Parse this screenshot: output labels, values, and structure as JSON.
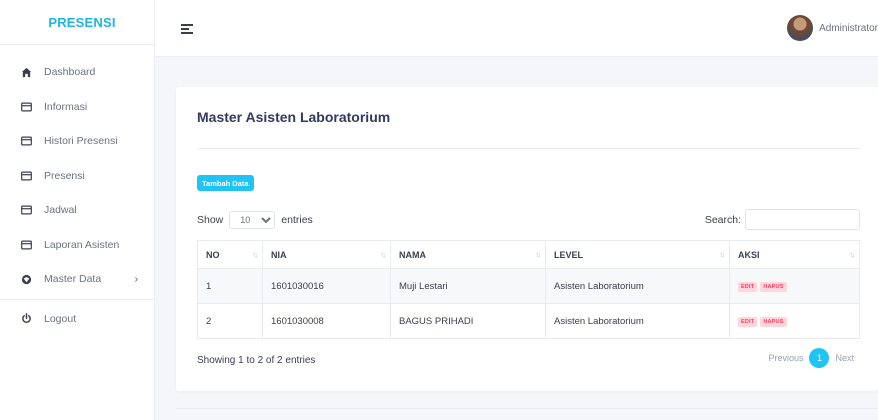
{
  "sidebar": {
    "brand": "PRESENSI",
    "items": [
      {
        "label": "Dashboard",
        "icon": "home-icon"
      },
      {
        "label": "Informasi",
        "icon": "card-icon"
      },
      {
        "label": "Histori Presensi",
        "icon": "card-icon"
      },
      {
        "label": "Presensi",
        "icon": "card-icon"
      },
      {
        "label": "Jadwal",
        "icon": "card-icon"
      },
      {
        "label": "Laporan Asisten",
        "icon": "card-icon"
      },
      {
        "label": "Master Data",
        "icon": "database-icon",
        "chevron": "›"
      },
      {
        "label": "Logout",
        "icon": "power-icon"
      }
    ]
  },
  "topbar": {
    "user_name": "Administrator"
  },
  "card": {
    "title": "Master Asisten Laboratorium",
    "add_button": "Tambah Data",
    "show_label": "Show",
    "entries_value": "10",
    "entries_label": "entries",
    "search_label": "Search:",
    "columns": [
      "NO",
      "NIA",
      "NAMA",
      "LEVEL",
      "AKSI"
    ],
    "rows": [
      {
        "no": "1",
        "nia": "1601030016",
        "nama": "Muji Lestari",
        "level": "Asisten Laboratorium",
        "edit": "EDIT",
        "hapus": "HAPUS"
      },
      {
        "no": "2",
        "nia": "1601030008",
        "nama": "BAGUS PRIHADI",
        "level": "Asisten Laboratorium",
        "edit": "EDIT",
        "hapus": "HAPUS"
      }
    ],
    "info": "Showing 1 to 2 of 2 entries",
    "pagination": {
      "previous": "Previous",
      "current": "1",
      "next": "Next"
    }
  },
  "colors": {
    "accent": "#21c3f3",
    "brand": "#1cb5e0",
    "danger": "#ff3b5c"
  }
}
